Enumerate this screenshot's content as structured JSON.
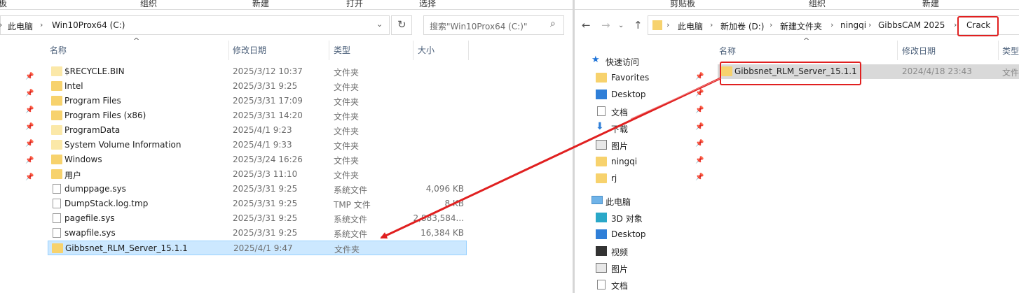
{
  "left": {
    "ribbon": [
      "板",
      "组织",
      "新建",
      "打开",
      "选择"
    ],
    "breadcrumb": [
      "此电脑",
      "Win10Prox64 (C:)"
    ],
    "search_placeholder": "搜索\"Win10Prox64 (C:)\"",
    "columns": {
      "name": "名称",
      "date": "修改日期",
      "type": "类型",
      "size": "大小"
    },
    "files": [
      {
        "name": "$RECYCLE.BIN",
        "date": "2025/3/12 10:37",
        "type": "文件夹",
        "size": "",
        "icon": "folder-light-icon"
      },
      {
        "name": "Intel",
        "date": "2025/3/31 9:25",
        "type": "文件夹",
        "size": "",
        "icon": "folder-icon"
      },
      {
        "name": "Program Files",
        "date": "2025/3/31 17:09",
        "type": "文件夹",
        "size": "",
        "icon": "folder-icon"
      },
      {
        "name": "Program Files (x86)",
        "date": "2025/3/31 14:20",
        "type": "文件夹",
        "size": "",
        "icon": "folder-icon"
      },
      {
        "name": "ProgramData",
        "date": "2025/4/1 9:23",
        "type": "文件夹",
        "size": "",
        "icon": "folder-light-icon"
      },
      {
        "name": "System Volume Information",
        "date": "2025/4/1 9:33",
        "type": "文件夹",
        "size": "",
        "icon": "folder-light-icon"
      },
      {
        "name": "Windows",
        "date": "2025/3/24 16:26",
        "type": "文件夹",
        "size": "",
        "icon": "folder-icon"
      },
      {
        "name": "用户",
        "date": "2025/3/3 11:10",
        "type": "文件夹",
        "size": "",
        "icon": "folder-icon"
      },
      {
        "name": "dumppage.sys",
        "date": "2025/3/31 9:25",
        "type": "系统文件",
        "size": "4,096 KB",
        "icon": "file-icon"
      },
      {
        "name": "DumpStack.log.tmp",
        "date": "2025/3/31 9:25",
        "type": "TMP 文件",
        "size": "8 KB",
        "icon": "file-icon"
      },
      {
        "name": "pagefile.sys",
        "date": "2025/3/31 9:25",
        "type": "系统文件",
        "size": "2,883,584...",
        "icon": "file-icon"
      },
      {
        "name": "swapfile.sys",
        "date": "2025/3/31 9:25",
        "type": "系统文件",
        "size": "16,384 KB",
        "icon": "file-icon"
      },
      {
        "name": "Gibbsnet_RLM_Server_15.1.1",
        "date": "2025/4/1 9:47",
        "type": "文件夹",
        "size": "",
        "icon": "folder-icon"
      }
    ]
  },
  "right": {
    "ribbon": [
      "剪贴板",
      "组织",
      "新建"
    ],
    "breadcrumb": [
      "此电脑",
      "新加卷 (D:)",
      "新建文件夹",
      "ningqi",
      "GibbsCAM 2025",
      "Crack"
    ],
    "columns": {
      "name": "名称",
      "date": "修改日期",
      "type": "类型"
    },
    "files": [
      {
        "name": "Gibbsnet_RLM_Server_15.1.1",
        "date": "2024/4/18 23:43",
        "type": "文件"
      }
    ],
    "quick_access": "快速访问",
    "nav_items": [
      {
        "label": "Favorites",
        "icon": "folder-icon"
      },
      {
        "label": "Desktop",
        "icon": "desktop-icon"
      },
      {
        "label": "文档",
        "icon": "document-icon"
      },
      {
        "label": "下载",
        "icon": "download-icon"
      },
      {
        "label": "图片",
        "icon": "pictures-icon"
      },
      {
        "label": "ningqi",
        "icon": "folder-icon"
      },
      {
        "label": "rj",
        "icon": "folder-icon"
      }
    ],
    "this_pc": "此电脑",
    "pc_items": [
      {
        "label": "3D 对象",
        "icon": "3d-objects-icon"
      },
      {
        "label": "Desktop",
        "icon": "desktop-icon"
      },
      {
        "label": "视频",
        "icon": "video-icon"
      },
      {
        "label": "图片",
        "icon": "pictures-icon"
      },
      {
        "label": "文档",
        "icon": "document-icon"
      }
    ]
  },
  "colors": {
    "selection": "#cce8ff",
    "highlight": "#e02020",
    "folder": "#f7d26d"
  }
}
